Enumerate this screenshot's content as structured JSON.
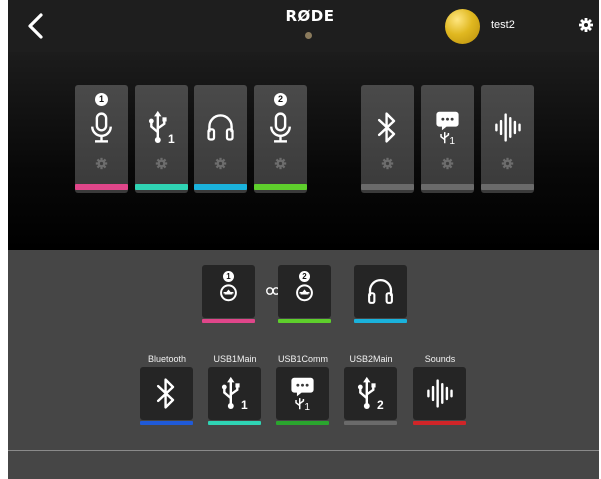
{
  "header": {
    "logo": "RØDE",
    "username": "test2"
  },
  "top_channels": [
    {
      "badge": "1",
      "icon": "microphone-icon",
      "color": "#e0468a"
    },
    {
      "badge": "",
      "icon": "usb-1-icon",
      "color": "#2fd4b4"
    },
    {
      "badge": "",
      "icon": "headphones-icon",
      "color": "#1ab2dc"
    },
    {
      "badge": "2",
      "icon": "microphone-icon",
      "color": "#5ecf2c"
    },
    {
      "badge": "",
      "icon": "bluetooth-icon",
      "color": "#6a6a6a"
    },
    {
      "badge": "",
      "icon": "chat-usb-1-icon",
      "color": "#6a6a6a"
    },
    {
      "badge": "",
      "icon": "sound-wave-icon",
      "color": "#6a6a6a"
    }
  ],
  "mix_outputs": [
    {
      "badge": "1",
      "icon": "mixer-output-icon",
      "color": "#e0468a"
    },
    {
      "badge": "2",
      "icon": "mixer-output-icon",
      "color": "#5ecf2c"
    },
    {
      "badge": "",
      "icon": "headphones-icon",
      "color": "#1ab2dc"
    }
  ],
  "link_icon": "chain-link-icon",
  "sources": [
    {
      "label": "Bluetooth",
      "icon": "bluetooth-icon",
      "color": "#1f5ad8"
    },
    {
      "label": "USB1Main",
      "icon": "usb-1-icon",
      "color": "#2fd4b4"
    },
    {
      "label": "USB1Comm",
      "icon": "chat-usb-1-icon",
      "color": "#2aa52e"
    },
    {
      "label": "USB2Main",
      "icon": "usb-2-icon",
      "color": "#6a6a6a"
    },
    {
      "label": "Sounds",
      "icon": "sound-wave-icon",
      "color": "#d02528"
    }
  ]
}
